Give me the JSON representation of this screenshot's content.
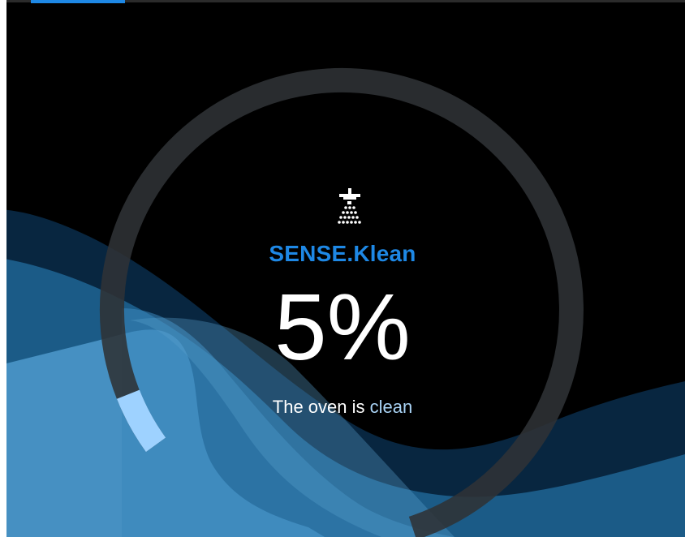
{
  "program": {
    "title": "SENSE.Klean",
    "icon": "shower-icon",
    "progress_percent": 5,
    "progress_label": "5%",
    "status_prefix": "The oven is ",
    "status_value": "clean"
  },
  "colors": {
    "accent": "#1e88e5",
    "arc_track": "#2f3236",
    "arc_fill": "#9ed2ff",
    "wave_dark": "#0a2840",
    "wave_mid": "#1c5a86",
    "wave_light": "#4a93c4",
    "status_accent": "#a9d3f5"
  }
}
